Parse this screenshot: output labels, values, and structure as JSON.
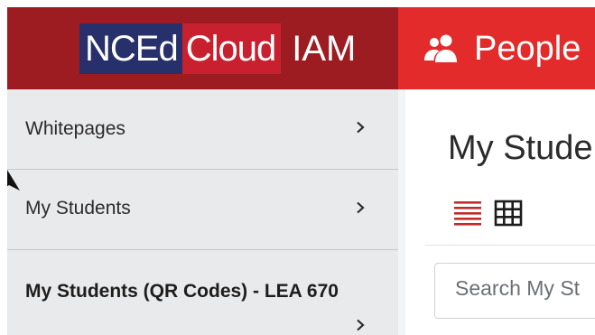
{
  "brand": {
    "logo_nc": "NCEd",
    "logo_cloud": "Cloud",
    "logo_iam": "IAM",
    "colors": {
      "header_bg": "#9c1c21",
      "nc_box": "#27306b",
      "cloud_box": "#c8202e"
    }
  },
  "appbar": {
    "title": "People",
    "icon": "people-icon",
    "color": "#e32b2b"
  },
  "sidebar": {
    "items": [
      {
        "label": "Whitepages",
        "icon": "chevron-right-icon"
      },
      {
        "label": "My Students",
        "icon": "chevron-right-icon"
      },
      {
        "label": "My Students (QR Codes) - LEA 670",
        "icon": "chevron-right-icon",
        "active": true
      }
    ]
  },
  "main": {
    "title": "My Stude",
    "views": [
      {
        "icon": "list-view-icon",
        "selected": true
      },
      {
        "icon": "grid-view-icon",
        "selected": false
      }
    ],
    "search": {
      "placeholder": "Search My St",
      "value": ""
    }
  }
}
